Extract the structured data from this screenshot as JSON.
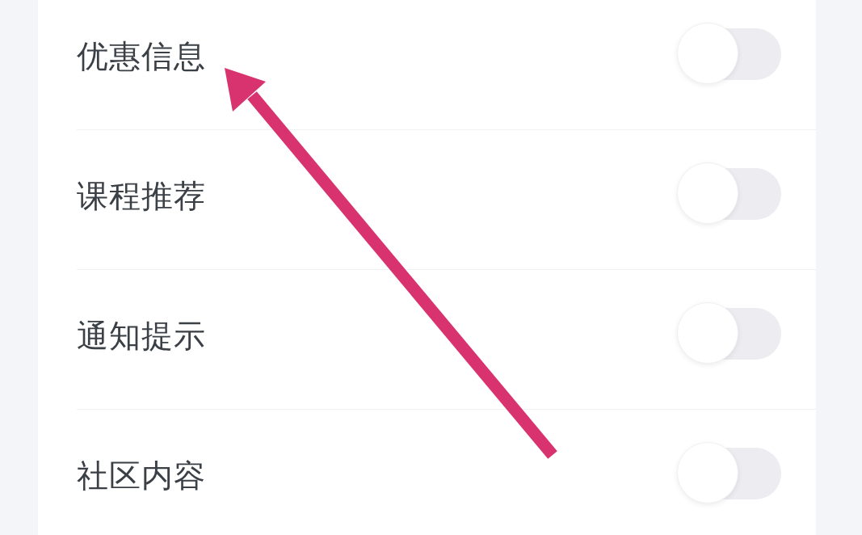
{
  "settings": [
    {
      "label": "优惠信息",
      "on": false
    },
    {
      "label": "课程推荐",
      "on": false
    },
    {
      "label": "通知提示",
      "on": false
    },
    {
      "label": "社区内容",
      "on": false
    }
  ]
}
